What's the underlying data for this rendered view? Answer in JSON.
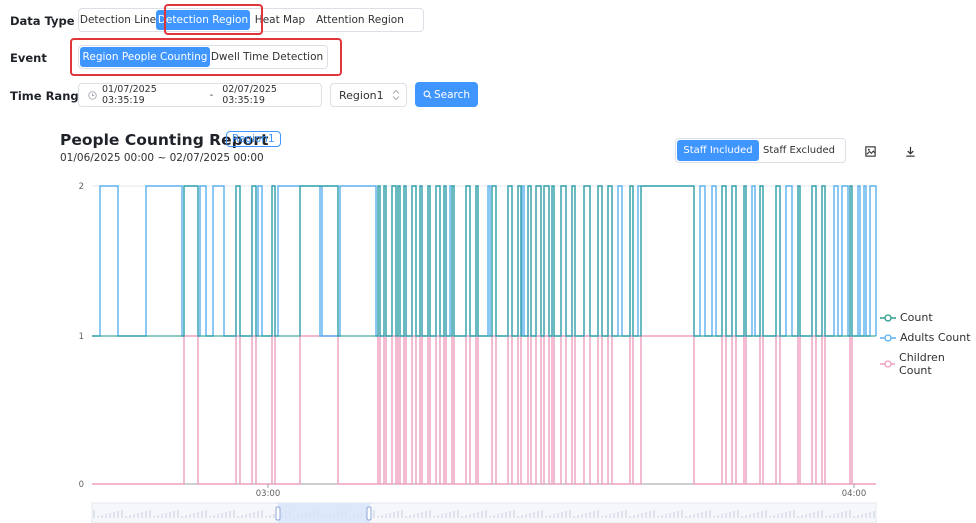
{
  "filters": {
    "data_type": {
      "label": "Data Type",
      "options": [
        "Detection Line",
        "Detection Region",
        "Heat Map",
        "Attention Region"
      ],
      "selected": "Detection Region"
    },
    "event": {
      "label": "Event",
      "options": [
        "Region People Counting",
        "Dwell Time Detection"
      ],
      "selected": "Region People Counting"
    },
    "time_range": {
      "label": "Time Range",
      "start": "01/07/2025 03:35:19",
      "separator": "-",
      "end": "02/07/2025 03:35:19",
      "region_value": "Region1",
      "search_label": "Search"
    }
  },
  "report": {
    "title": "People Counting Report",
    "region_tag": "Region1",
    "range": "01/06/2025 00:00 ~ 02/07/2025 00:00",
    "staff_toggle": {
      "options": [
        "Staff Included",
        "Staff Excluded"
      ],
      "selected": "Staff Included"
    }
  },
  "chart_data": {
    "type": "line",
    "step": true,
    "y_ticks": [
      "0",
      "1",
      "2"
    ],
    "ylim": [
      0,
      2
    ],
    "x_ticks": [
      "03:00",
      "04:00"
    ],
    "legend_position": "right",
    "grid": true,
    "colors": {
      "count": "#2a9d8f",
      "adults": "#5ab1ef",
      "children": "#ef9fbf"
    },
    "series": [
      {
        "name": "Count",
        "key": "count"
      },
      {
        "name": "Adults Count",
        "key": "adults"
      },
      {
        "name": "Children Count",
        "key": "children"
      }
    ],
    "children_on": [
      [
        184,
        198
      ],
      [
        236,
        240
      ],
      [
        252,
        256
      ],
      [
        272,
        275
      ],
      [
        300,
        338
      ],
      [
        378,
        380
      ],
      [
        384,
        386
      ],
      [
        392,
        396
      ],
      [
        398,
        400
      ],
      [
        404,
        406
      ],
      [
        412,
        416
      ],
      [
        420,
        422
      ],
      [
        428,
        430
      ],
      [
        436,
        440
      ],
      [
        444,
        446
      ],
      [
        452,
        454
      ],
      [
        466,
        470
      ],
      [
        476,
        478
      ],
      [
        492,
        496
      ],
      [
        508,
        512
      ],
      [
        518,
        521
      ],
      [
        528,
        531
      ],
      [
        536,
        541
      ],
      [
        544,
        549
      ],
      [
        552,
        554
      ],
      [
        561,
        566
      ],
      [
        572,
        575
      ],
      [
        584,
        590
      ],
      [
        598,
        602
      ],
      [
        608,
        612
      ],
      [
        630,
        633
      ],
      [
        641,
        694
      ],
      [
        722,
        726
      ],
      [
        732,
        736
      ],
      [
        744,
        746
      ],
      [
        760,
        763
      ],
      [
        776,
        780
      ],
      [
        798,
        800
      ],
      [
        812,
        816
      ],
      [
        822,
        825
      ],
      [
        850,
        852
      ]
    ],
    "adults_extra": [
      [
        100,
        118
      ],
      [
        146,
        182
      ],
      [
        200,
        206
      ],
      [
        213,
        224
      ],
      [
        258,
        262
      ],
      [
        278,
        300
      ],
      [
        320,
        322
      ],
      [
        340,
        376
      ],
      [
        450,
        452
      ],
      [
        488,
        490
      ],
      [
        522,
        524
      ],
      [
        618,
        622
      ],
      [
        638,
        641
      ],
      [
        700,
        705
      ],
      [
        712,
        716
      ],
      [
        752,
        755
      ],
      [
        786,
        792
      ],
      [
        834,
        838
      ],
      [
        842,
        848
      ],
      [
        858,
        860
      ],
      [
        864,
        866
      ],
      [
        870,
        876
      ]
    ]
  }
}
